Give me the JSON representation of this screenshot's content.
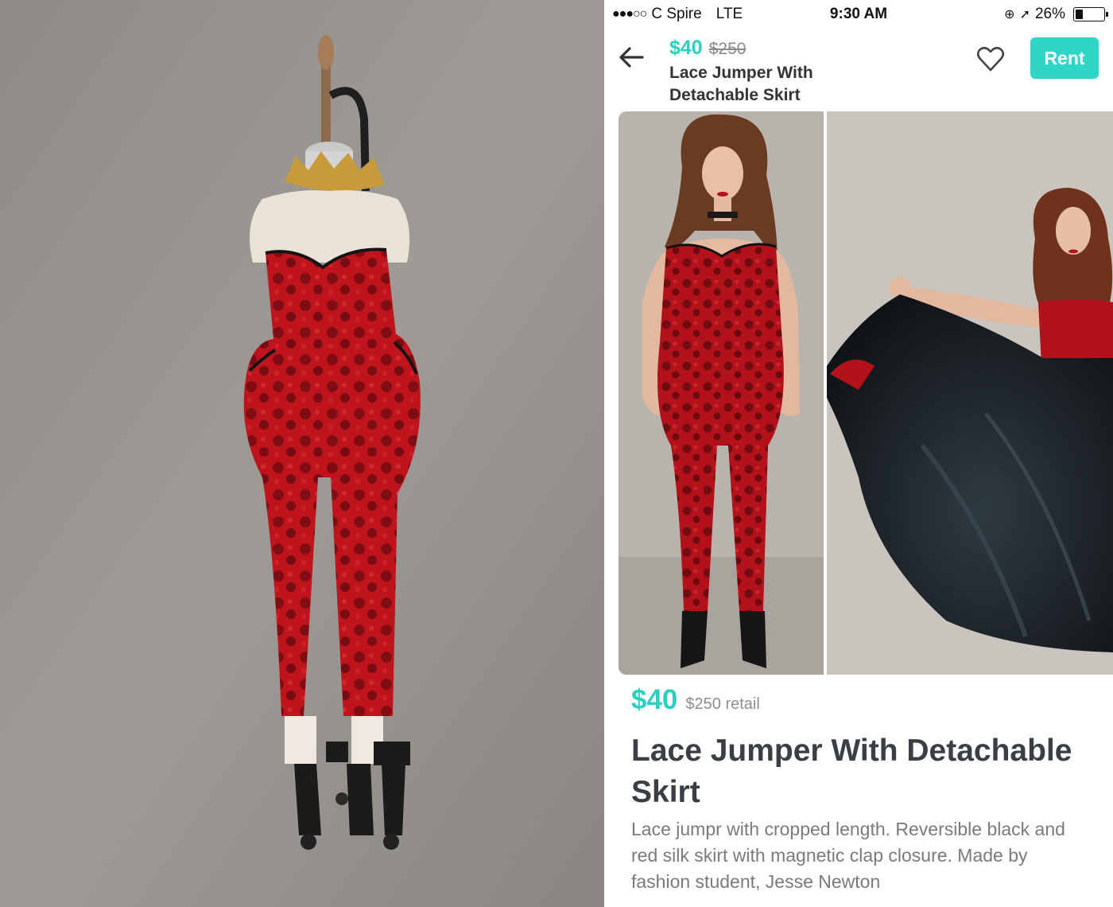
{
  "status_bar": {
    "signal": "●●●○○",
    "carrier": "C Spire",
    "network": "LTE",
    "time": "9:30 AM",
    "lock_glyph": "⊕",
    "location_glyph": "➚",
    "battery_percent_text": "26%",
    "battery_level": 0.26
  },
  "header": {
    "back_icon": "arrow-left-icon",
    "price": "$40",
    "original_price": "$250",
    "title": "Lace Jumper With Detachable Skirt",
    "favorite_icon": "heart-outline-icon",
    "rent_label": "Rent"
  },
  "details": {
    "price": "$40",
    "retail": "$250 retail",
    "title": "Lace Jumper With Detachable Skirt",
    "description": "Lace jumpr with cropped length. Reversible black and red silk skirt with magnetic clap closure. Made by fashion student, Jesse Newton"
  },
  "colors": {
    "accent": "#2ed6c8",
    "price_text": "#2ecfc3",
    "title_text": "#3a3f45",
    "muted_text": "#7a7a7a",
    "garment_red": "#b3121b",
    "skirt_black": "#1c2226"
  }
}
